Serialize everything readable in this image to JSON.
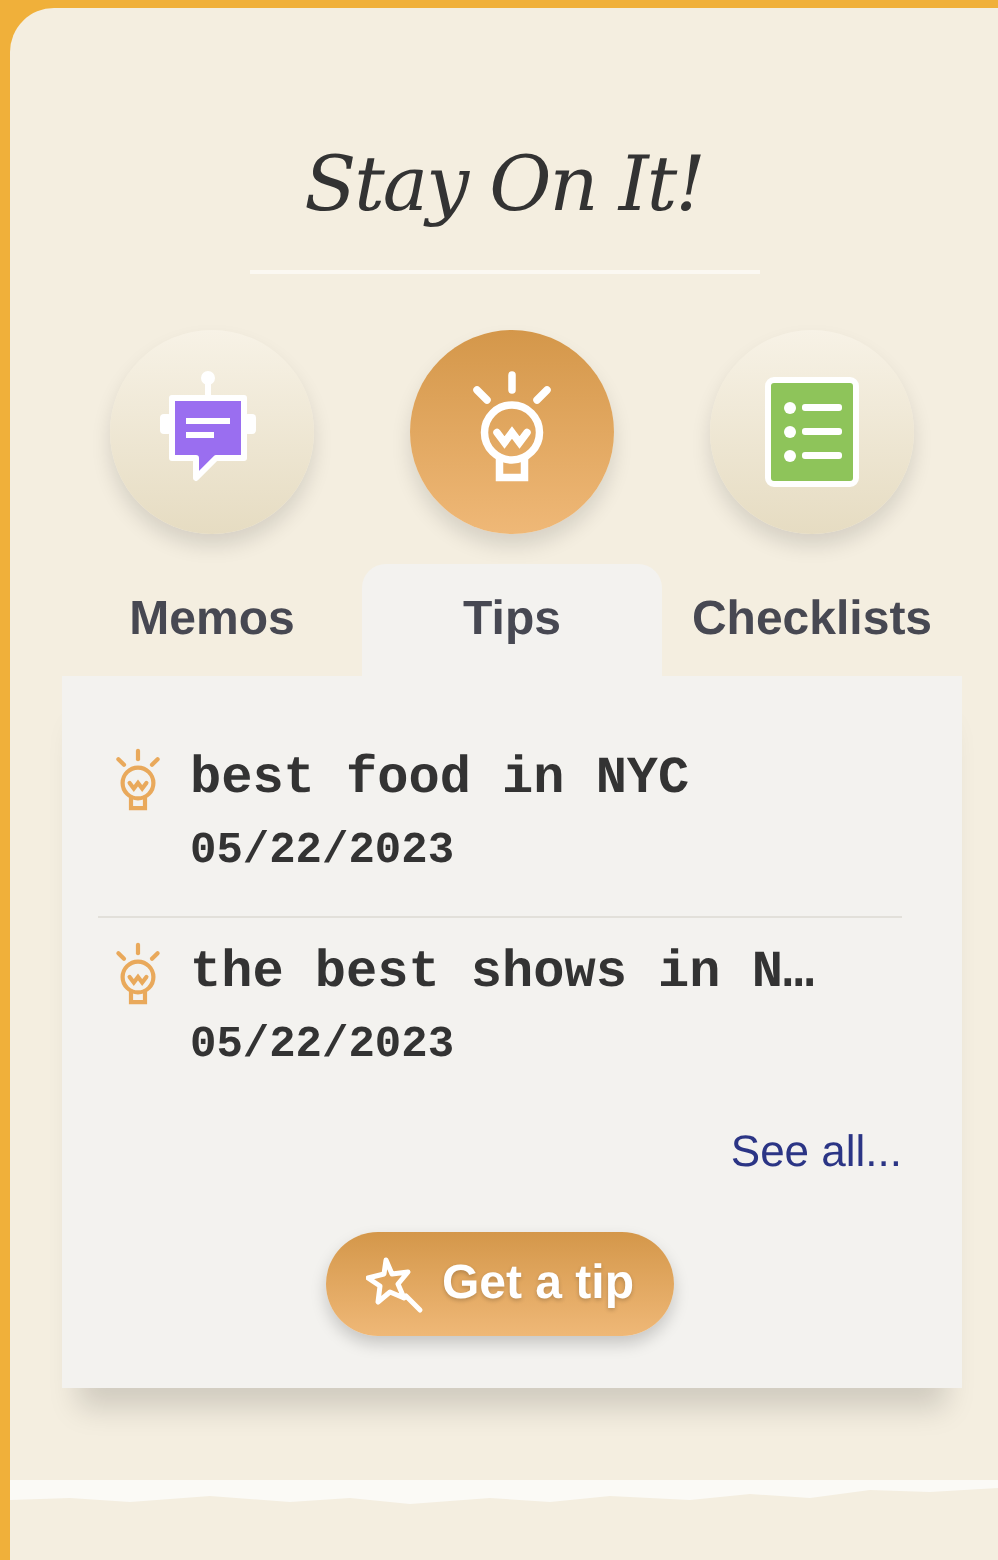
{
  "title": "Stay On It!",
  "tabs": [
    {
      "label": "Memos",
      "kind": "memo",
      "selected": false
    },
    {
      "label": "Tips",
      "kind": "tip",
      "selected": true
    },
    {
      "label": "Checklists",
      "kind": "checklist",
      "selected": false
    }
  ],
  "items": [
    {
      "title": "best food in NYC",
      "date": "05/22/2023"
    },
    {
      "title": "the best shows in N…",
      "date": "05/22/2023"
    }
  ],
  "see_all": "See all...",
  "action_button": "Get a tip"
}
